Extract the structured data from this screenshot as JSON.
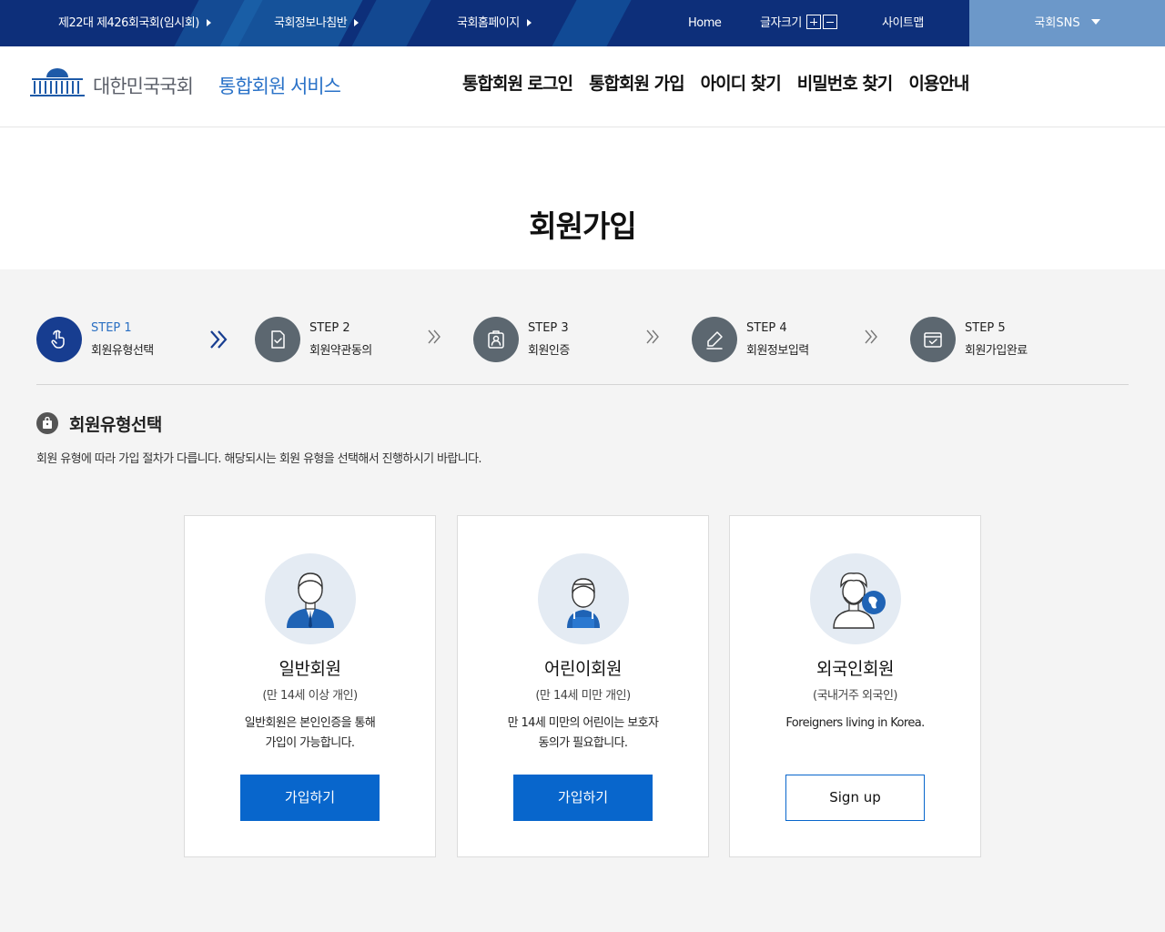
{
  "topbar": {
    "session_link": "제22대 제426회국회(임시회)",
    "info_link": "국회정보나침반",
    "homepage_link": "국회홈페이지",
    "home_link": "Home",
    "font_size_label": "글자크기",
    "sitemap_link": "사이트맵",
    "sns_label": "국회SNS"
  },
  "header": {
    "brand": "대한민국국회",
    "service": "통합회원 서비스",
    "nav": [
      "통합회원 로그인",
      "통합회원 가입",
      "아이디 찾기",
      "비밀번호 찾기",
      "이용안내"
    ]
  },
  "page": {
    "title": "회원가입"
  },
  "steps": [
    {
      "num": "STEP 1",
      "label": "회원유형선택",
      "icon": "hand-pointer-icon",
      "active": true
    },
    {
      "num": "STEP 2",
      "label": "회원약관동의",
      "icon": "document-check-icon",
      "active": false
    },
    {
      "num": "STEP 3",
      "label": "회원인증",
      "icon": "id-badge-icon",
      "active": false
    },
    {
      "num": "STEP 4",
      "label": "회원정보입력",
      "icon": "pencil-icon",
      "active": false
    },
    {
      "num": "STEP 5",
      "label": "회원가입완료",
      "icon": "complete-check-icon",
      "active": false
    }
  ],
  "section": {
    "title": "회원유형선택",
    "description": "회원 유형에 따라 가입 절차가 다릅니다. 해당되시는 회원 유형을 선택해서 진행하시기 바랍니다."
  },
  "cards": [
    {
      "title": "일반회원",
      "sub": "(만 14세 이상 개인)",
      "desc": [
        "일반회원은 본인인증을 통해",
        "가입이 가능합니다."
      ],
      "button": "가입하기"
    },
    {
      "title": "어린이회원",
      "sub": "(만 14세 미만 개인)",
      "desc": [
        "만 14세 미만의 어린이는 보호자",
        "동의가 필요합니다."
      ],
      "button": "가입하기"
    },
    {
      "title": "외국인회원",
      "sub": "(국내거주 외국인)",
      "desc": [
        "Foreigners living in Korea."
      ],
      "button": "Sign up"
    }
  ],
  "colors": {
    "navy": "#0d2f7a",
    "accent": "#0866cc",
    "active_step": "#173d90",
    "sns_bg": "#6c98c9"
  }
}
